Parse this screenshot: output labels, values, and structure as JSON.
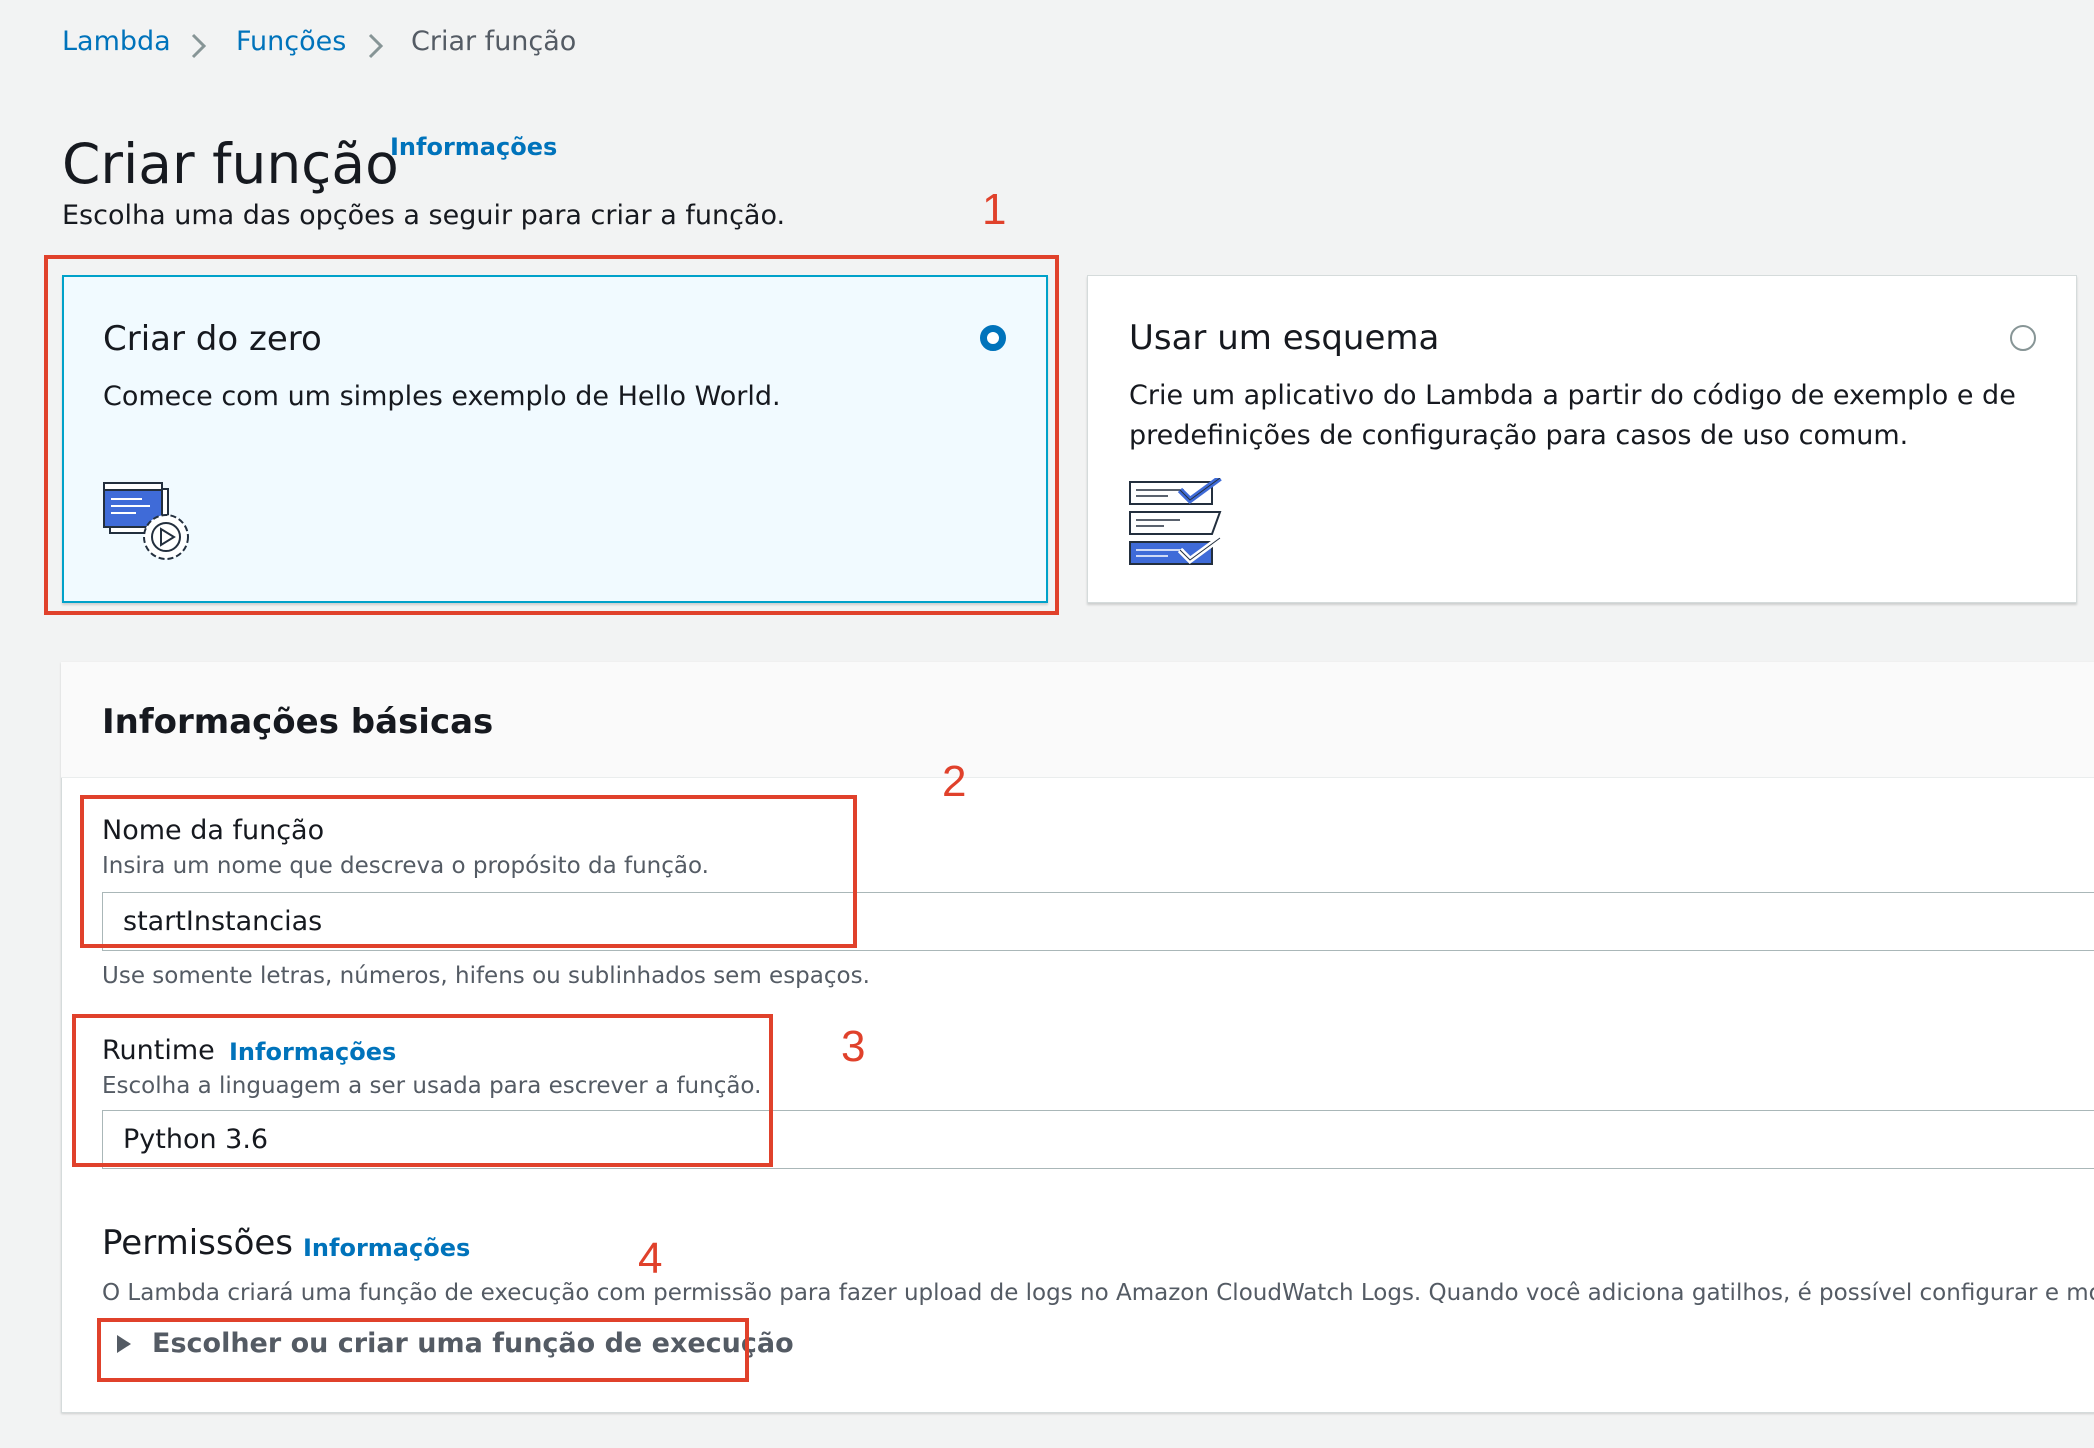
{
  "breadcrumb": {
    "items": [
      "Lambda",
      "Funções",
      "Criar função"
    ]
  },
  "page": {
    "title": "Criar função",
    "info_link": "Informações",
    "intro": "Escolha uma das opções a seguir para criar a função."
  },
  "options": {
    "from_scratch": {
      "title": "Criar do zero",
      "description": "Comece com um simples exemplo de Hello World.",
      "selected": true,
      "icon": "code-gear-play-icon"
    },
    "blueprint": {
      "title": "Usar um esquema",
      "description_line1": "Crie um aplicativo do Lambda a partir do código de exemplo e de",
      "description_line2": "predefinições de configuração para casos de uso comum.",
      "selected": false,
      "icon": "checklist-icon"
    }
  },
  "basic_info": {
    "title": "Informações básicas",
    "function_name": {
      "label": "Nome da função",
      "description": "Insira um nome que descreva o propósito da função.",
      "value": "startInstancias",
      "constraint": "Use somente letras, números, hifens ou sublinhados sem espaços."
    },
    "runtime": {
      "label": "Runtime",
      "info_link": "Informações",
      "description": "Escolha a linguagem a ser usada para escrever a função.",
      "value": "Python 3.6"
    },
    "permissions": {
      "label": "Permissões",
      "info_link": "Informações",
      "description": "O Lambda criará uma função de execução com permissão para fazer upload de logs no Amazon CloudWatch Logs. Quando você adiciona gatilhos, é possível configurar e modificar perm",
      "expander": "Escolher ou criar uma função de execução"
    }
  },
  "annotations": [
    "1",
    "2",
    "3",
    "4"
  ],
  "colors": {
    "link": "#0073bb",
    "annotation": "#e0412b",
    "selected_card_bg": "#f1faff",
    "selected_card_border": "#00a1c9",
    "page_bg": "#f2f3f3"
  }
}
